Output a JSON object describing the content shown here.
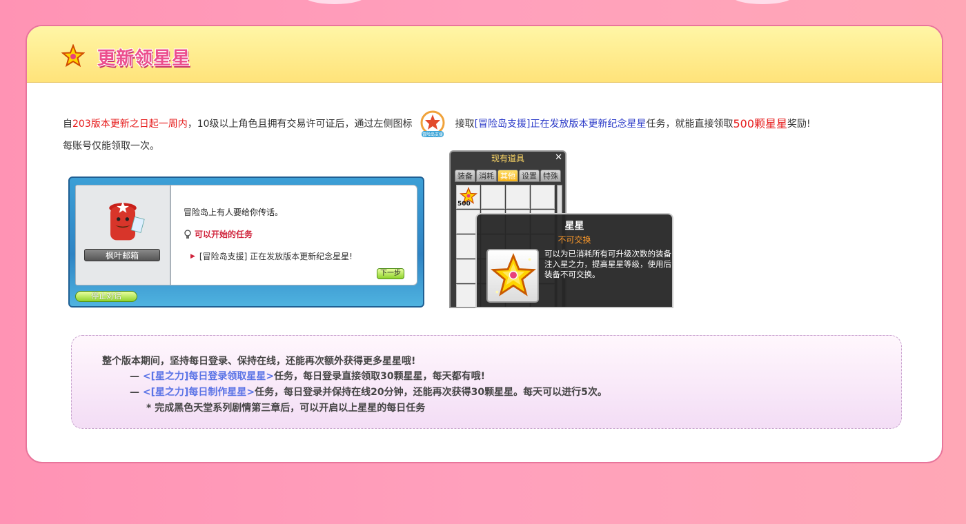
{
  "header": {
    "title": "更新领星星"
  },
  "intro": {
    "p1_a": "自",
    "p1_highlight": "203版本更新之日起一周内",
    "p1_b": "，10级以上角色且拥有交易许可证后，通过左侧图标",
    "support_icon_label": "冒险岛支援",
    "p1_c": "接取",
    "quest_link": "[冒险岛支援]正在发放版本更新纪念星星",
    "p1_d": "任务，就能直接领取",
    "reward": "500颗星星",
    "p1_e": "奖励!",
    "p2": "每账号仅能领取一次。"
  },
  "npc_dialog": {
    "npc_name": "枫叶邮箱",
    "line1": "冒险岛上有人要给你传话。",
    "quest_header": "可以开始的任务",
    "quest_item": "[冒险岛支援] 正在发放版本更新纪念星星!",
    "next_button": "下一步",
    "stop_button": "停止对话"
  },
  "inventory": {
    "title": "现有道具",
    "close": "✕",
    "tabs": [
      "装备",
      "消耗",
      "其他",
      "设置",
      "特殊"
    ],
    "active_tab": "其他",
    "item_count": "500"
  },
  "tooltip": {
    "name": "星星",
    "tradability": "不可交换",
    "description": "可以为已消耗所有可升级次数的装备注入星之力，提高星星等级，使用后装备不可交换。"
  },
  "bottom": {
    "title": "整个版本期间，坚持每日登录、保持在线，还能再次额外获得更多星星哦!",
    "line1_dash": "—",
    "line1_link": "<[星之力]每日登录领取星星>",
    "line1_text": "任务，每日登录直接领取30颗星星，每天都有哦!",
    "line2_dash": "—",
    "line2_link": "<[星之力]每日制作星星>",
    "line2_text": "任务，每日登录并保持在线20分钟，还能再次获得30颗星星。每天可以进行5次。",
    "note": "* 完成黑色天堂系列剧情第三章后，可以开启以上星星的每日任务"
  },
  "colors": {
    "accent_pink": "#ec4f8e",
    "highlight_red": "#e61b1b",
    "link_blue": "#2a39c8",
    "link_periwinkle": "#5a73e6",
    "header_yellow": "#ffe37a"
  }
}
